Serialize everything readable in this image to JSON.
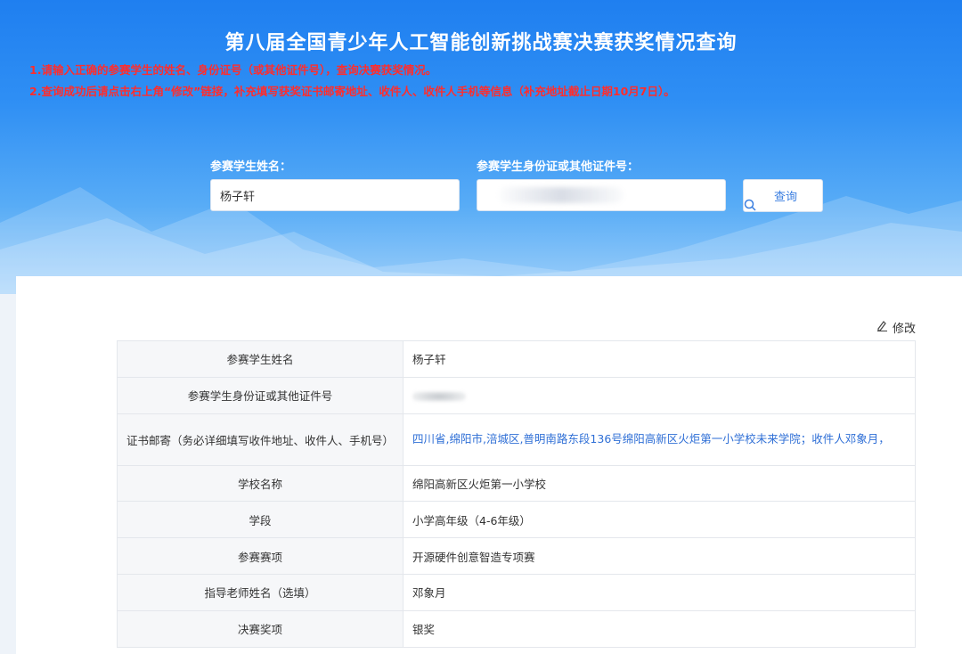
{
  "header": {
    "title": "第八届全国青少年人工智能创新挑战赛决赛获奖情况查询",
    "notice1": "1.请输入正确的参赛学生的姓名、身份证号（或其他证件号），查询决赛获奖情况。",
    "notice2": "2.查询成功后请点击右上角“修改”链接，补充填写获奖证书邮寄地址、收件人、收件人手机等信息（补充地址截止日期10月7日）。"
  },
  "search": {
    "name_label": "参赛学生姓名：",
    "name_value": "杨子轩",
    "id_label": "参赛学生身份证或其他证件号：",
    "id_value": "",
    "button_label": "查询"
  },
  "result": {
    "edit_label": "修改",
    "rows": [
      {
        "key": "参赛学生姓名",
        "value": "杨子轩"
      },
      {
        "key": "参赛学生身份证或其他证件号",
        "value": ""
      },
      {
        "key": "证书邮寄（务必详细填写收件地址、收件人、手机号）",
        "value": "四川省,绵阳市,涪城区,普明南路东段136号绵阳高新区火炬第一小学校未来学院；收件人邓象月，"
      },
      {
        "key": "学校名称",
        "value": "绵阳高新区火炬第一小学校"
      },
      {
        "key": "学段",
        "value": "小学高年级（4-6年级）"
      },
      {
        "key": "参赛赛项",
        "value": "开源硬件创意智造专项赛"
      },
      {
        "key": "指导老师姓名（选填）",
        "value": "邓象月"
      },
      {
        "key": "决赛奖项",
        "value": "银奖"
      }
    ]
  },
  "colors": {
    "hero_top": "#1f7ff0",
    "notice_red": "#ff2d2d",
    "link_blue": "#2f6fd6"
  },
  "icons": [
    "search-icon",
    "edit-icon"
  ]
}
